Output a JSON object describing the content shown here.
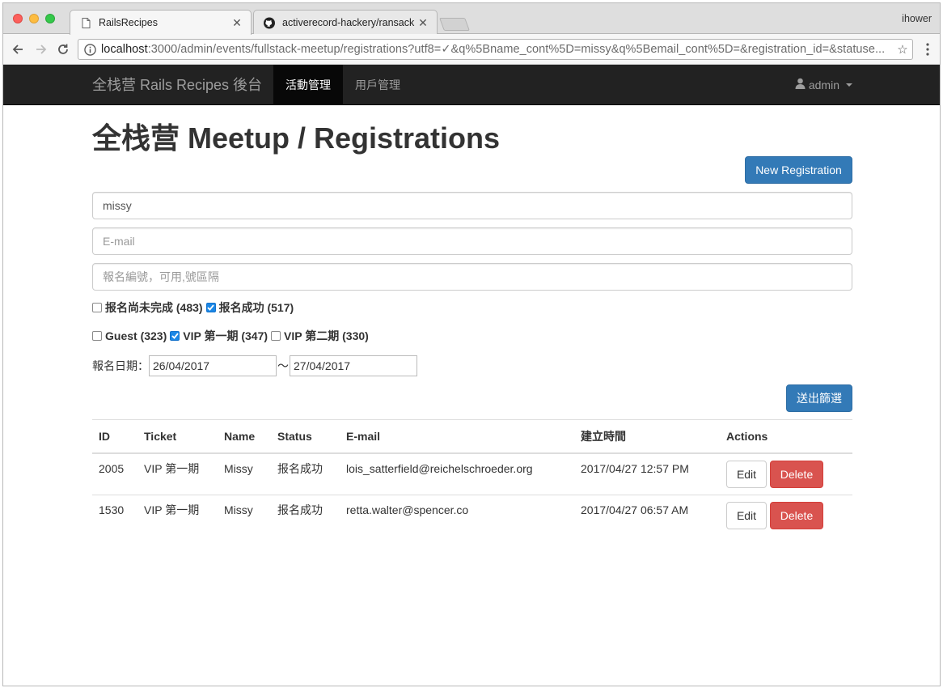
{
  "browser": {
    "tabs": [
      {
        "label": "RailsRecipes",
        "active": true,
        "icon": "page-icon"
      },
      {
        "label": "activerecord-hackery/ransack",
        "active": false,
        "icon": "github-icon"
      }
    ],
    "profile_name": "ihower",
    "url_host": "localhost",
    "url_rest": ":3000/admin/events/fullstack-meetup/registrations?utf8=✓&q%5Bname_cont%5D=missy&q%5Bemail_cont%5D=&registration_id=&statuse..."
  },
  "navbar": {
    "brand": "全栈营 Rails Recipes 後台",
    "items": [
      {
        "label": "活動管理",
        "active": true
      },
      {
        "label": "用戶管理",
        "active": false
      }
    ],
    "user_label": "admin"
  },
  "page": {
    "title": "全栈营 Meetup / Registrations",
    "new_button": "New Registration"
  },
  "filters": {
    "name_value": "missy",
    "email_placeholder": "E-mail",
    "regid_placeholder": "報名編號，可用,號區隔",
    "status_options": [
      {
        "label": "报名尚未完成 (483)",
        "checked": false
      },
      {
        "label": "报名成功 (517)",
        "checked": true
      }
    ],
    "ticket_options": [
      {
        "label": "Guest (323)",
        "checked": false
      },
      {
        "label": "VIP 第一期 (347)",
        "checked": true
      },
      {
        "label": "VIP 第二期 (330)",
        "checked": false
      }
    ],
    "date_label": "報名日期：",
    "date_from": "26/04/2017",
    "date_separator": "～",
    "date_to": "27/04/2017",
    "submit_label": "送出篩選"
  },
  "table": {
    "columns": [
      "ID",
      "Ticket",
      "Name",
      "Status",
      "E-mail",
      "建立時間",
      "Actions"
    ],
    "rows": [
      {
        "id": "2005",
        "ticket": "VIP 第一期",
        "name": "Missy",
        "status": "报名成功",
        "email": "lois_satterfield@reichelschroeder.org",
        "created": "2017/04/27 12:57 PM"
      },
      {
        "id": "1530",
        "ticket": "VIP 第一期",
        "name": "Missy",
        "status": "报名成功",
        "email": "retta.walter@spencer.co",
        "created": "2017/04/27 06:57 AM"
      }
    ],
    "edit_label": "Edit",
    "delete_label": "Delete"
  },
  "colors": {
    "navbar_bg": "#222222",
    "primary": "#337ab7",
    "danger": "#d9534f",
    "checkbox_checked": "#1b87e6"
  }
}
